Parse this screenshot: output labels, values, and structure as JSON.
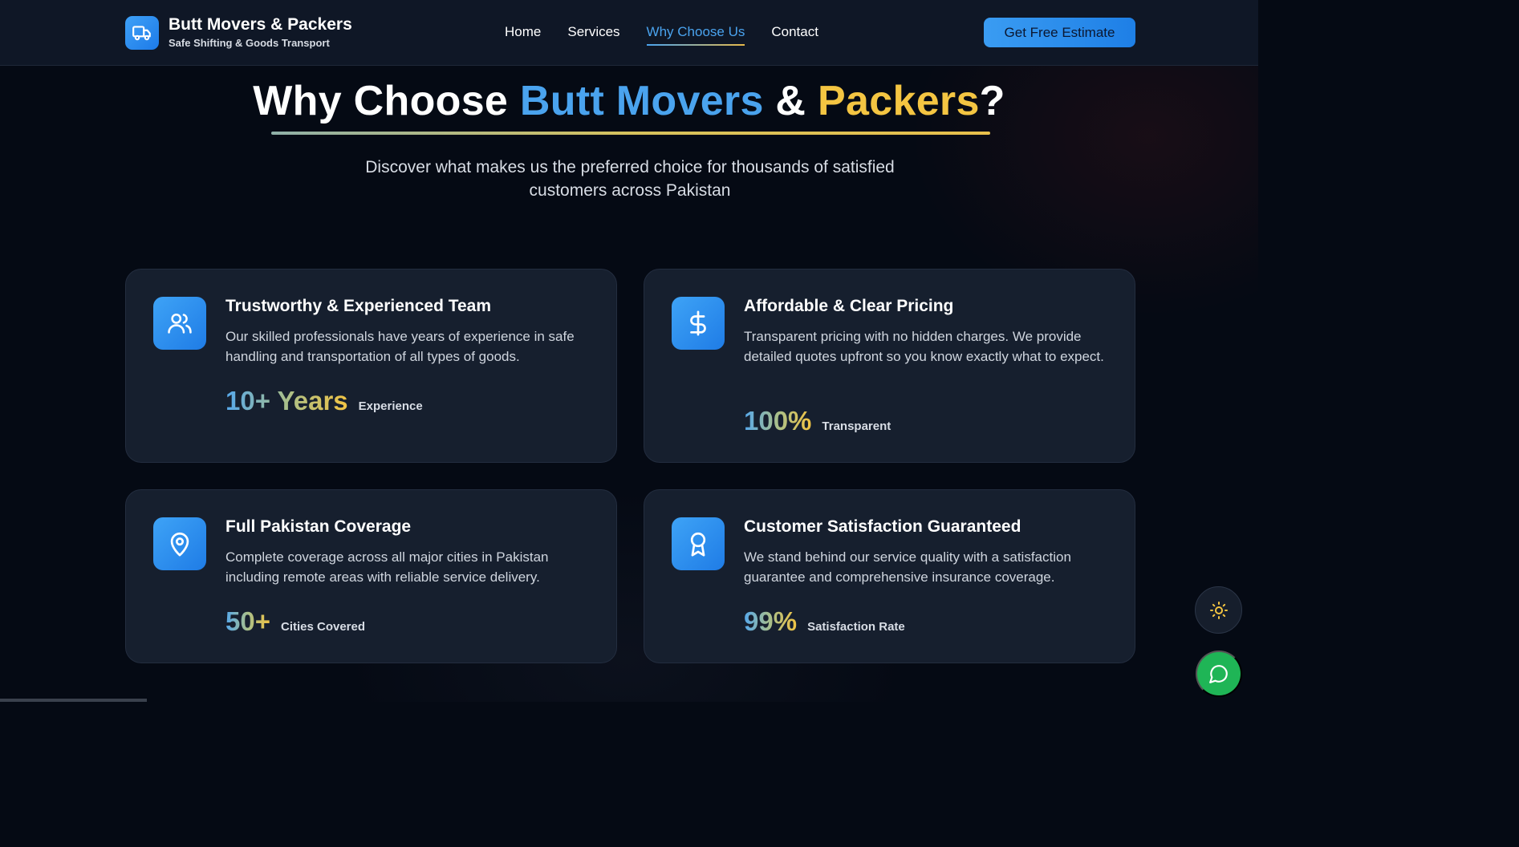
{
  "brand": {
    "name": "Butt Movers & Packers",
    "tagline": "Safe Shifting & Goods Transport",
    "icon": "truck-icon"
  },
  "nav": {
    "items": [
      {
        "label": "Home",
        "active": false
      },
      {
        "label": "Services",
        "active": false
      },
      {
        "label": "Why Choose Us",
        "active": true
      },
      {
        "label": "Contact",
        "active": false
      }
    ],
    "cta_label": "Get Free Estimate"
  },
  "hero": {
    "title_part1": "Why Choose ",
    "title_blue": "Butt Movers",
    "title_part2": " & ",
    "title_gold": "Packers",
    "title_part3": "?",
    "subtitle": "Discover what makes us the preferred choice for thousands of satisfied customers across Pakistan"
  },
  "cards": [
    {
      "icon": "users-icon",
      "title": "Trustworthy & Experienced Team",
      "description": "Our skilled professionals have years of experience in safe handling and transportation of all types of goods.",
      "stat_value": "10+ Years",
      "stat_label": "Experience"
    },
    {
      "icon": "dollar-icon",
      "title": "Affordable & Clear Pricing",
      "description": "Transparent pricing with no hidden charges. We provide detailed quotes upfront so you know exactly what to expect.",
      "stat_value": "100%",
      "stat_label": "Transparent"
    },
    {
      "icon": "map-pin-icon",
      "title": "Full Pakistan Coverage",
      "description": "Complete coverage across all major cities in Pakistan including remote areas with reliable service delivery.",
      "stat_value": "50+",
      "stat_label": "Cities Covered"
    },
    {
      "icon": "award-icon",
      "title": "Customer Satisfaction Guaranteed",
      "description": "We stand behind our service quality with a satisfaction guarantee and comprehensive insurance coverage.",
      "stat_value": "99%",
      "stat_label": "Satisfaction Rate"
    }
  ],
  "floating": {
    "theme_icon": "sun-icon",
    "chat_icon": "chat-bubble-icon"
  },
  "colors": {
    "accent_blue": "#4aa3ee",
    "accent_gold": "#f4c542",
    "chat_green": "#1fb556",
    "card_bg": "#161f2e"
  }
}
